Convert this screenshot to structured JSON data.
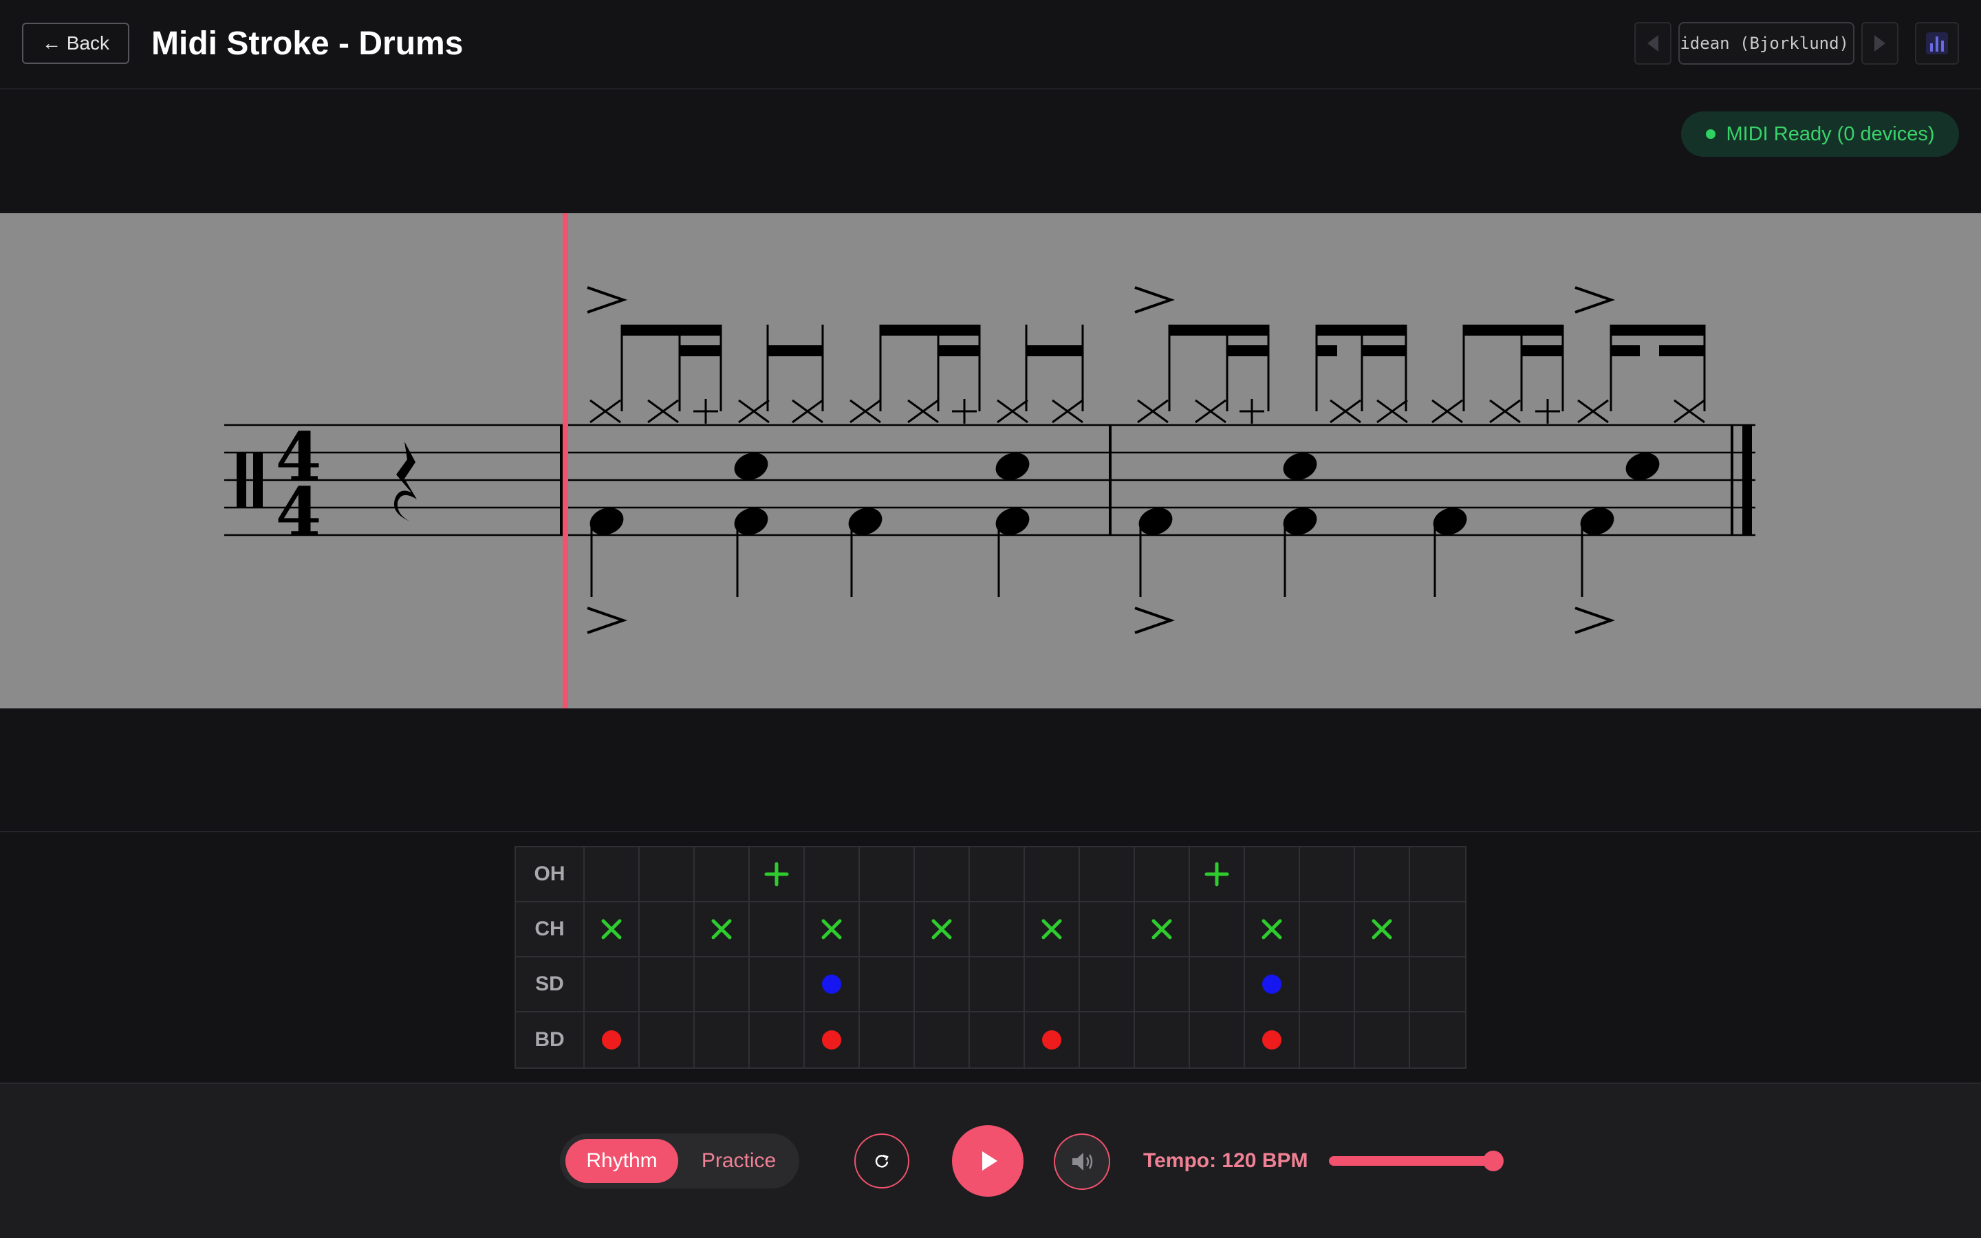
{
  "header": {
    "back_label": "← Back",
    "title": "Midi Stroke - Drums",
    "pattern_name": "idean (Bjorklund)"
  },
  "midi_status": {
    "label": "MIDI Ready (0 devices)",
    "color": "#2fd160"
  },
  "sequencer": {
    "rows": [
      {
        "label": "OH",
        "steps": [
          "",
          "",
          "",
          "+",
          "",
          "",
          "",
          "",
          "",
          "",
          "",
          "+",
          "",
          "",
          "",
          ""
        ]
      },
      {
        "label": "CH",
        "steps": [
          "x",
          "",
          "x",
          "",
          "x",
          "",
          "x",
          "",
          "x",
          "",
          "x",
          "",
          "x",
          "",
          "x",
          ""
        ]
      },
      {
        "label": "SD",
        "steps": [
          "",
          "",
          "",
          "",
          "o",
          "",
          "",
          "",
          "",
          "",
          "",
          "",
          "o",
          "",
          "",
          ""
        ]
      },
      {
        "label": "BD",
        "steps": [
          "o",
          "",
          "",
          "",
          "o",
          "",
          "",
          "",
          "o",
          "",
          "",
          "",
          "o",
          "",
          "",
          ""
        ]
      }
    ],
    "colors": {
      "OH": "#2ecc2e",
      "CH": "#2ecc2e",
      "SD": "#1616f0",
      "BD": "#ee1c1c"
    }
  },
  "controls": {
    "modes": [
      "Rhythm",
      "Practice"
    ],
    "active_mode": "Rhythm",
    "tempo_label": "Tempo: 120 BPM",
    "tempo_level": 0.95,
    "accent_color": "#f2526d"
  },
  "icons": {
    "prev": "triangle-left-icon",
    "next": "triangle-right-icon",
    "stats": "bar-chart-icon",
    "reset": "reset-icon",
    "play": "play-icon",
    "sound": "speaker-icon"
  }
}
